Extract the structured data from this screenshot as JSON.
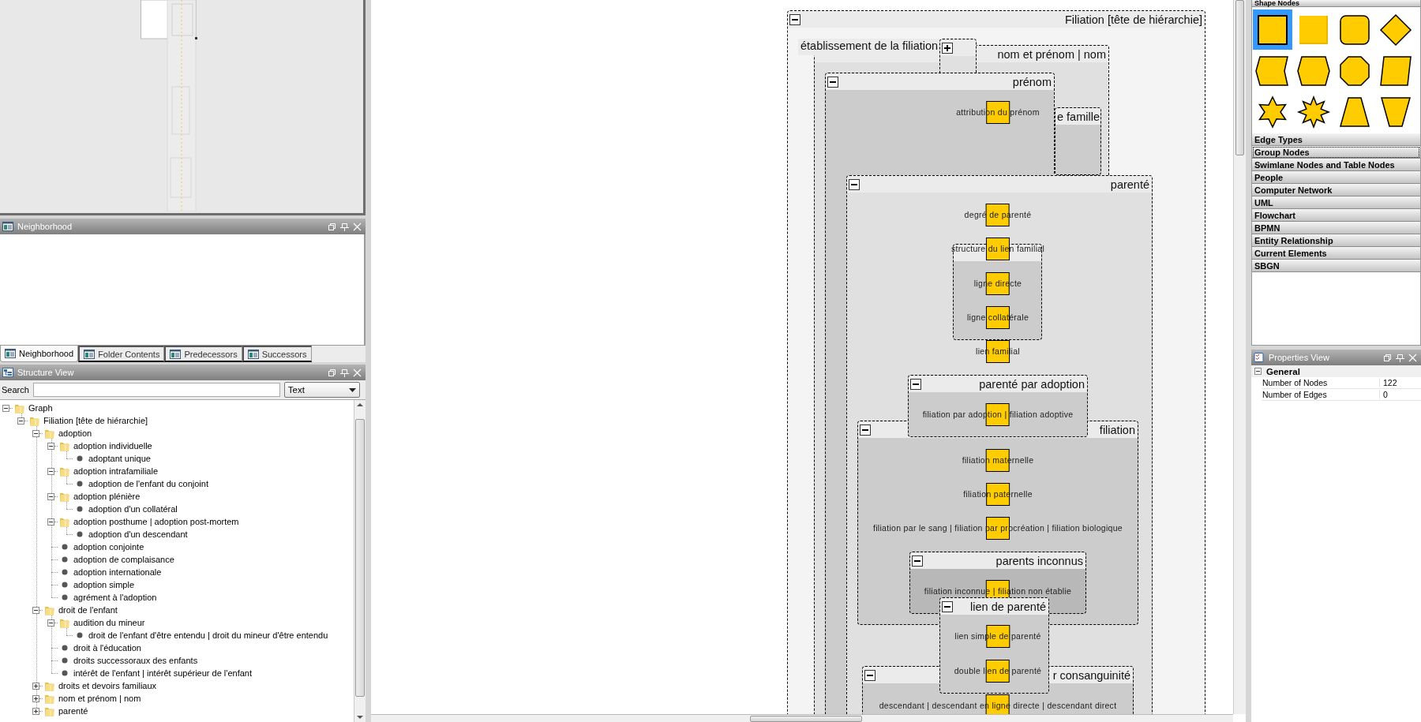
{
  "neighborhood": {
    "title": "Neighborhood"
  },
  "dock_tabs": [
    {
      "label": "Neighborhood",
      "selected": true
    },
    {
      "label": "Folder Contents",
      "selected": false
    },
    {
      "label": "Predecessors",
      "selected": false
    },
    {
      "label": "Successors",
      "selected": false
    }
  ],
  "structure_view": {
    "title": "Structure View",
    "search_label": "Search",
    "mode": "Text",
    "tree": [
      {
        "label": "Graph",
        "kind": "folder",
        "expanded": true,
        "children": [
          {
            "label": "Filiation [tête de hiérarchie]",
            "kind": "folder",
            "expanded": true,
            "children": [
              {
                "label": "adoption",
                "kind": "folder",
                "expanded": true,
                "children": [
                  {
                    "label": "adoption individuelle",
                    "kind": "folder",
                    "expanded": true,
                    "children": [
                      {
                        "label": "adoptant unique",
                        "kind": "leaf"
                      }
                    ]
                  },
                  {
                    "label": "adoption intrafamiliale",
                    "kind": "folder",
                    "expanded": true,
                    "children": [
                      {
                        "label": "adoption de l'enfant du conjoint",
                        "kind": "leaf"
                      }
                    ]
                  },
                  {
                    "label": "adoption plénière",
                    "kind": "folder",
                    "expanded": true,
                    "children": [
                      {
                        "label": "adoption d'un collatéral",
                        "kind": "leaf"
                      }
                    ]
                  },
                  {
                    "label": "adoption posthume | adoption post-mortem",
                    "kind": "folder",
                    "expanded": true,
                    "children": [
                      {
                        "label": "adoption d'un descendant",
                        "kind": "leaf"
                      }
                    ]
                  },
                  {
                    "label": "adoption conjointe",
                    "kind": "leaf"
                  },
                  {
                    "label": "adoption de complaisance",
                    "kind": "leaf"
                  },
                  {
                    "label": "adoption internationale",
                    "kind": "leaf"
                  },
                  {
                    "label": "adoption simple",
                    "kind": "leaf"
                  },
                  {
                    "label": "agrément à l'adoption",
                    "kind": "leaf"
                  }
                ]
              },
              {
                "label": "droit de l'enfant",
                "kind": "folder",
                "expanded": true,
                "children": [
                  {
                    "label": "audition du mineur",
                    "kind": "folder",
                    "expanded": true,
                    "children": [
                      {
                        "label": "droit de l'enfant d'être entendu | droit du mineur d'être entendu",
                        "kind": "leaf"
                      }
                    ]
                  },
                  {
                    "label": "droit à l'éducation",
                    "kind": "leaf"
                  },
                  {
                    "label": "droits successoraux des enfants",
                    "kind": "leaf"
                  },
                  {
                    "label": "intérêt de l'enfant | intérêt supérieur de l'enfant",
                    "kind": "leaf"
                  }
                ]
              },
              {
                "label": "droits et devoirs familiaux",
                "kind": "folder",
                "expanded": false
              },
              {
                "label": "nom et prénom | nom",
                "kind": "folder",
                "expanded": false
              },
              {
                "label": "parenté",
                "kind": "folder",
                "expanded": false
              }
            ]
          }
        ]
      }
    ]
  },
  "diagram": {
    "items": [
      {
        "kind": "group",
        "title": "Filiation [tête de hiérarchie]",
        "expanded": true
      },
      {
        "kind": "group",
        "title": "nom et prénom | nom"
      },
      {
        "kind": "label",
        "title": "établissement de la filiation"
      },
      {
        "kind": "group",
        "expanded": false
      },
      {
        "kind": "group",
        "title": "e famille"
      },
      {
        "kind": "group",
        "title": "prénom",
        "expanded": true
      },
      {
        "kind": "node",
        "label": "attribution du prénom"
      },
      {
        "kind": "group",
        "title": "parenté",
        "expanded": true
      },
      {
        "kind": "node",
        "label": "degré de parenté"
      },
      {
        "kind": "group"
      },
      {
        "kind": "node",
        "label": "structure du lien familial"
      },
      {
        "kind": "node",
        "label": "ligne directe"
      },
      {
        "kind": "node",
        "label": "ligne collatérale"
      },
      {
        "kind": "node",
        "label": "lien familial"
      },
      {
        "kind": "group",
        "title": "filiation",
        "expanded": true
      },
      {
        "kind": "group",
        "title": "parenté par adoption",
        "expanded": true
      },
      {
        "kind": "node",
        "label": "filiation par adoption | filiation adoptive"
      },
      {
        "kind": "node",
        "label": "filiation maternelle"
      },
      {
        "kind": "node",
        "label": "filiation paternelle"
      },
      {
        "kind": "node",
        "label": "filiation par le sang | filiation par procréation | filiation biologique"
      },
      {
        "kind": "group",
        "title": "parents inconnus",
        "expanded": true
      },
      {
        "kind": "node",
        "label": "filiation inconnue | filiation non établie"
      },
      {
        "kind": "group",
        "title": "r consanguinité",
        "expanded": true
      },
      {
        "kind": "group",
        "title": "lien de parenté",
        "expanded": true
      },
      {
        "kind": "node",
        "label": "lien simple de parenté"
      },
      {
        "kind": "node",
        "label": "double lien de parenté"
      },
      {
        "kind": "node",
        "label": "descendant | descendant en ligne directe | descendant direct"
      }
    ]
  },
  "palette": {
    "sections": [
      {
        "title": "Shape Nodes",
        "focused": false,
        "shapes": [
          {
            "kind": "rectangle",
            "selected": true
          },
          {
            "kind": "rectangle3d",
            "selected": false
          },
          {
            "kind": "roundrect",
            "selected": false
          },
          {
            "kind": "diamond",
            "selected": false
          },
          {
            "kind": "notched",
            "selected": false
          },
          {
            "kind": "hexagon",
            "selected": false
          },
          {
            "kind": "octagon",
            "selected": false
          },
          {
            "kind": "parallelogram",
            "selected": false
          },
          {
            "kind": "star6",
            "selected": false
          },
          {
            "kind": "star8",
            "selected": false
          },
          {
            "kind": "trapezoid",
            "selected": false
          },
          {
            "kind": "trapezoid2",
            "selected": false
          }
        ]
      },
      {
        "title": "Edge Types",
        "focused": false
      },
      {
        "title": "Group Nodes",
        "focused": true
      },
      {
        "title": "Swimlane Nodes and Table Nodes",
        "focused": false
      },
      {
        "title": "People",
        "focused": false
      },
      {
        "title": "Computer Network",
        "focused": false
      },
      {
        "title": "UML",
        "focused": false
      },
      {
        "title": "Flowchart",
        "focused": false
      },
      {
        "title": "BPMN",
        "focused": false
      },
      {
        "title": "Entity Relationship",
        "focused": false
      },
      {
        "title": "Current Elements",
        "focused": false
      },
      {
        "title": "SBGN",
        "focused": false
      }
    ]
  },
  "properties": {
    "title": "Properties View",
    "groups": [
      {
        "title": "General",
        "expanded": true,
        "rows": [
          {
            "name": "Number of Nodes",
            "value": "122"
          },
          {
            "name": "Number of Edges",
            "value": "0"
          }
        ]
      }
    ]
  }
}
